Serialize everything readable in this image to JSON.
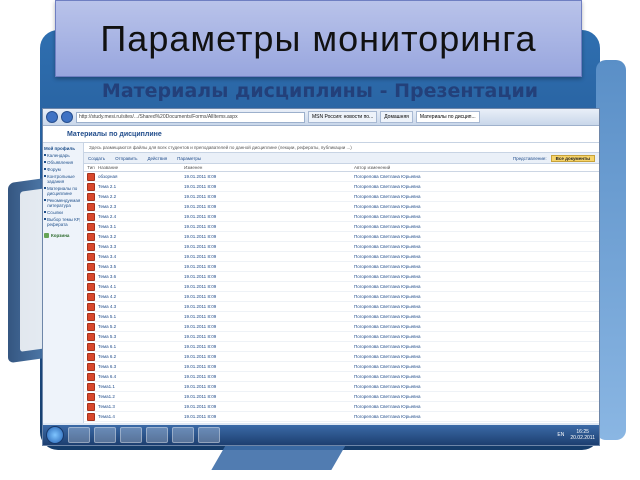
{
  "slide": {
    "title": "Параметры  мониторинга",
    "subtitle": "Материалы дисциплины - Презентации"
  },
  "browser": {
    "url": "http://study.mesi.ru/sites/.../Shared%20Documents/Forms/AllItems.aspx",
    "tabs": [
      "MSN Россия: новости по...",
      "Домашняя",
      "Материалы по дисцип..."
    ]
  },
  "site": {
    "heading": "Материалы по дисциплине",
    "info_text": "Здесь размещаются файлы для всех студентов и преподавателей по данной дисциплине (лекции, рефераты, публикации ...)",
    "toolbar": [
      "Создать",
      "Отправить",
      "Действия",
      "Параметры"
    ],
    "view_label": "Представление:",
    "view_value": "Все документы"
  },
  "sidebar": {
    "header": "Мой профиль",
    "items": [
      "Календарь",
      "Объявления",
      "Форум",
      "Контрольные задания",
      "Материалы по дисциплине",
      "Рекомендуемая литература",
      "Ссылки",
      "Выбор темы КР, реферата"
    ],
    "trash": "Корзина"
  },
  "columns": {
    "type": "Тип",
    "name": "Название",
    "modified": "Изменен",
    "author": "Автор изменений"
  },
  "rows": [
    {
      "name": "обзорная",
      "date": "19.01.2011 8:09",
      "author": "Погорелова Светлана Юрьевна"
    },
    {
      "name": "Тема 2.1",
      "date": "19.01.2011 8:09",
      "author": "Погорелова Светлана Юрьевна"
    },
    {
      "name": "Тема 2.2",
      "date": "19.01.2011 8:09",
      "author": "Погорелова Светлана Юрьевна"
    },
    {
      "name": "Тема 2.3",
      "date": "19.01.2011 8:09",
      "author": "Погорелова Светлана Юрьевна"
    },
    {
      "name": "Тема 2.4",
      "date": "19.01.2011 8:09",
      "author": "Погорелова Светлана Юрьевна"
    },
    {
      "name": "Тема 3.1",
      "date": "19.01.2011 8:09",
      "author": "Погорелова Светлана Юрьевна"
    },
    {
      "name": "Тема 3.2",
      "date": "19.01.2011 8:09",
      "author": "Погорелова Светлана Юрьевна"
    },
    {
      "name": "Тема 3.3",
      "date": "19.01.2011 8:09",
      "author": "Погорелова Светлана Юрьевна"
    },
    {
      "name": "Тема 3.4",
      "date": "19.01.2011 8:09",
      "author": "Погорелова Светлана Юрьевна"
    },
    {
      "name": "Тема 3.5",
      "date": "19.01.2011 8:09",
      "author": "Погорелова Светлана Юрьевна"
    },
    {
      "name": "Тема 3.6",
      "date": "19.01.2011 8:09",
      "author": "Погорелова Светлана Юрьевна"
    },
    {
      "name": "Тема 4.1",
      "date": "19.01.2011 8:09",
      "author": "Погорелова Светлана Юрьевна"
    },
    {
      "name": "Тема 4.2",
      "date": "19.01.2011 8:09",
      "author": "Погорелова Светлана Юрьевна"
    },
    {
      "name": "Тема 4.3",
      "date": "19.01.2011 8:09",
      "author": "Погорелова Светлана Юрьевна"
    },
    {
      "name": "Тема 5.1",
      "date": "19.01.2011 8:09",
      "author": "Погорелова Светлана Юрьевна"
    },
    {
      "name": "Тема 5.2",
      "date": "19.01.2011 8:09",
      "author": "Погорелова Светлана Юрьевна"
    },
    {
      "name": "Тема 5.3",
      "date": "19.01.2011 8:09",
      "author": "Погорелова Светлана Юрьевна"
    },
    {
      "name": "Тема 6.1",
      "date": "19.01.2011 8:09",
      "author": "Погорелова Светлана Юрьевна"
    },
    {
      "name": "Тема 6.2",
      "date": "19.01.2011 8:09",
      "author": "Погорелова Светлана Юрьевна"
    },
    {
      "name": "Тема 6.3",
      "date": "19.01.2011 8:09",
      "author": "Погорелова Светлана Юрьевна"
    },
    {
      "name": "Тема 6.4",
      "date": "19.01.2011 8:09",
      "author": "Погорелова Светлана Юрьевна"
    },
    {
      "name": "Тема1.1",
      "date": "19.01.2011 8:09",
      "author": "Погорелова Светлана Юрьевна"
    },
    {
      "name": "Тема1.2",
      "date": "19.01.2011 8:09",
      "author": "Погорелова Светлана Юрьевна"
    },
    {
      "name": "Тема1.3",
      "date": "19.01.2011 8:09",
      "author": "Погорелова Светлана Юрьевна"
    },
    {
      "name": "Тема1.4",
      "date": "19.01.2011 8:09",
      "author": "Погорелова Светлана Юрьевна"
    }
  ],
  "taskbar": {
    "lang": "EN",
    "time": "16:25",
    "date": "20.02.2011"
  },
  "colors": {
    "title_bg": "#a8b4e4",
    "subtitle": "#23407a",
    "frame": "#1e4f8a"
  }
}
